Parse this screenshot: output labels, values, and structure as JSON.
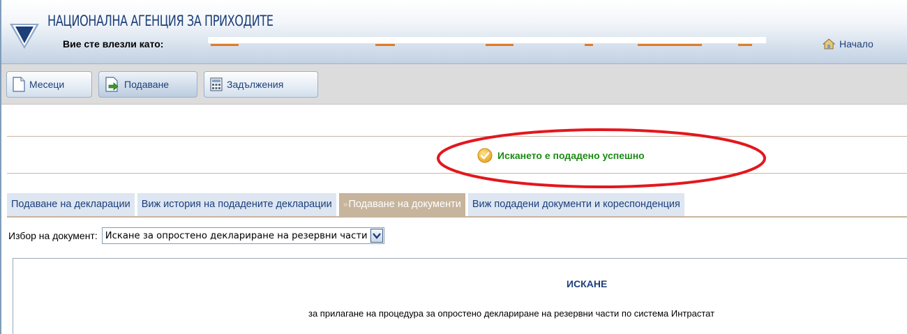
{
  "header": {
    "agency_name": "НАЦИОНАЛНА АГЕНЦИЯ ЗА ПРИХОДИТЕ",
    "logged_in_label": "Вие сте влезли като:",
    "home_label": "Начало"
  },
  "toolbar": {
    "months_label": "Месеци",
    "submit_label": "Подаване",
    "obligations_label": "Задължения"
  },
  "message": {
    "success_text": "Искането е подадено успешно"
  },
  "tabs": [
    {
      "label": "Подаване на декларации"
    },
    {
      "label": "Виж история на подадените декларации"
    },
    {
      "label": "Подаване на документи",
      "active": true
    },
    {
      "label": "Виж подадени документи и кореспонденция"
    }
  ],
  "doc_select": {
    "label": "Избор на документ:",
    "value": "Искане за опростено деклариране на резервни части"
  },
  "document": {
    "title": "ИСКАНЕ",
    "subtitle": "за прилагане на процедура за опростено деклариране на резервни части по система Интрастат"
  },
  "colors": {
    "brand_blue": "#1d3f7a",
    "success_green": "#1c8a14",
    "active_tab": "#c7b49c",
    "annotation_red": "#e3171d"
  }
}
